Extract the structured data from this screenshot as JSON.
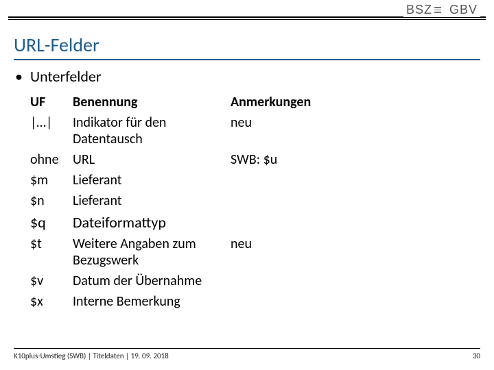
{
  "branding": {
    "logo1": "BSZ",
    "logo2": "GBV"
  },
  "title": "URL-Felder",
  "bullet": "Unterfelder",
  "table": {
    "headers": {
      "uf": "UF",
      "benennung": "Benennung",
      "anmerkungen": "Anmerkungen"
    },
    "rows": [
      {
        "uf": "|…|",
        "benennung": "Indikator für den Datentausch",
        "anmerkungen": "neu",
        "em": false
      },
      {
        "uf": "ohne",
        "benennung": "URL",
        "anmerkungen": "SWB: $u",
        "em": false
      },
      {
        "uf": "$m",
        "benennung": "Lieferant",
        "anmerkungen": "",
        "em": false
      },
      {
        "uf": "$n",
        "benennung": "Lieferant",
        "anmerkungen": "",
        "em": false
      },
      {
        "uf": "$q",
        "benennung": "Dateiformattyp",
        "anmerkungen": "",
        "em": true
      },
      {
        "uf": "$t",
        "benennung": "Weitere Angaben zum Bezugswerk",
        "anmerkungen": "neu",
        "em": false
      },
      {
        "uf": "$v",
        "benennung": "Datum der Übernahme",
        "anmerkungen": "",
        "em": false
      },
      {
        "uf": "$x",
        "benennung": "Interne Bemerkung",
        "anmerkungen": "",
        "em": false
      }
    ]
  },
  "footer": {
    "text": "K10plus-Umstieg (SWB) | Titeldaten | 19. 09. 2018",
    "page": "30"
  }
}
